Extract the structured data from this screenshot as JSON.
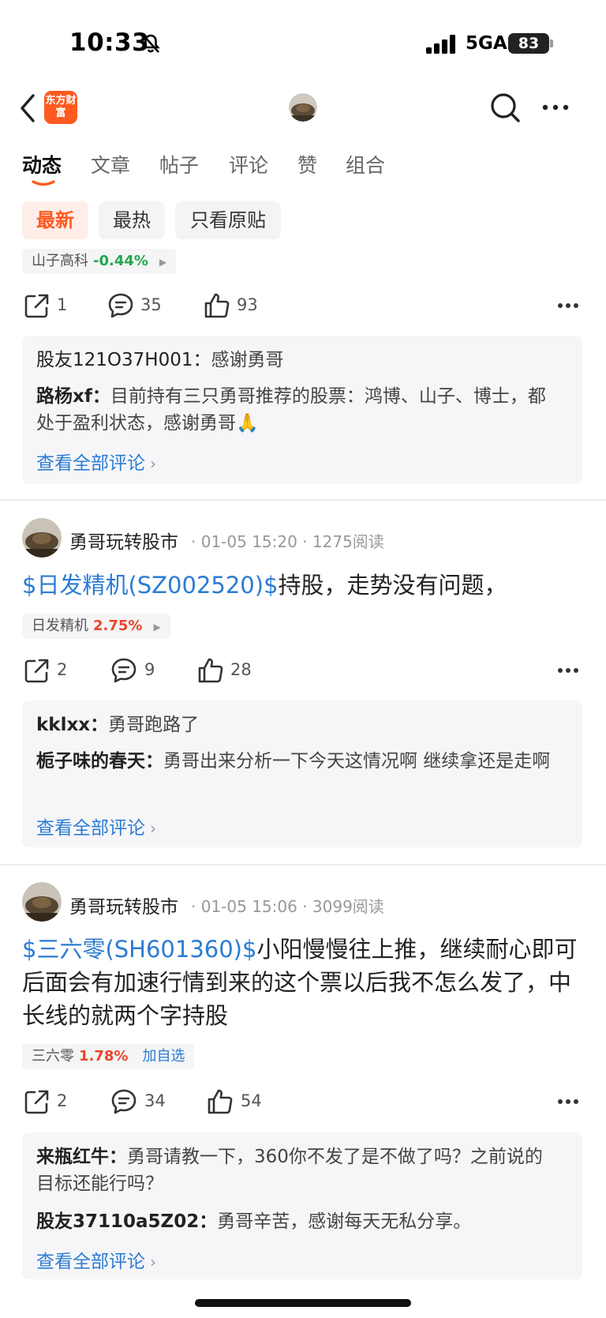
{
  "status_bar": {
    "time": "10:33",
    "network": "5GA",
    "battery": "83"
  },
  "header": {
    "logo_text": "东方财富"
  },
  "tabs": [
    "动态",
    "文章",
    "帖子",
    "评论",
    "赞",
    "组合"
  ],
  "filters": [
    "最新",
    "最热",
    "只看原贴"
  ],
  "post0": {
    "stock_name": "山子高科",
    "stock_change": "-0.44%",
    "shares": "1",
    "comments": "35",
    "likes": "93",
    "c1_user": "股友121O37H001：",
    "c1_text": "感谢勇哥",
    "c2_user": "路杨xf：",
    "c2_text": "目前持有三只勇哥推荐的股票：鸿博、山子、博士，都处于盈利状态，感谢勇哥🙏",
    "view_all": "查看全部评论"
  },
  "post1": {
    "author": "勇哥玩转股市",
    "time": "01-05 15:20",
    "reads": "1275阅读",
    "stock_tag": "$日发精机(SZ002520)$",
    "text": "持股，走势没有问题，",
    "stock_name": "日发精机",
    "stock_change": "2.75%",
    "shares": "2",
    "comments": "9",
    "likes": "28",
    "c1_user": "kklxx：",
    "c1_text": "勇哥跑路了",
    "c2_user": "栀子味的春天：",
    "c2_text": "勇哥出来分析一下今天这情况啊 继续拿还是走啊",
    "view_all": "查看全部评论"
  },
  "post2": {
    "author": "勇哥玩转股市",
    "time": "01-05 15:06",
    "reads": "3099阅读",
    "stock_tag": "$三六零(SH601360)$",
    "text": "小阳慢慢往上推，继续耐心即可后面会有加速行情到来的这个票以后我不怎么发了，中长线的就两个字持股",
    "stock_name": "三六零",
    "stock_change": "1.78%",
    "add_label": "加自选",
    "shares": "2",
    "comments": "34",
    "likes": "54",
    "c1_user": "来瓶红牛：",
    "c1_text": "勇哥请教一下，360你不发了是不做了吗？之前说的目标还能行吗？",
    "c2_user": "股友37110a5Z02：",
    "c2_text": "勇哥辛苦，感谢每天无私分享。",
    "view_all": "查看全部评论"
  },
  "colors": {
    "accent": "#ff5a1f",
    "link": "#2b7cd3",
    "up": "#e8462c",
    "down": "#22a84f"
  }
}
